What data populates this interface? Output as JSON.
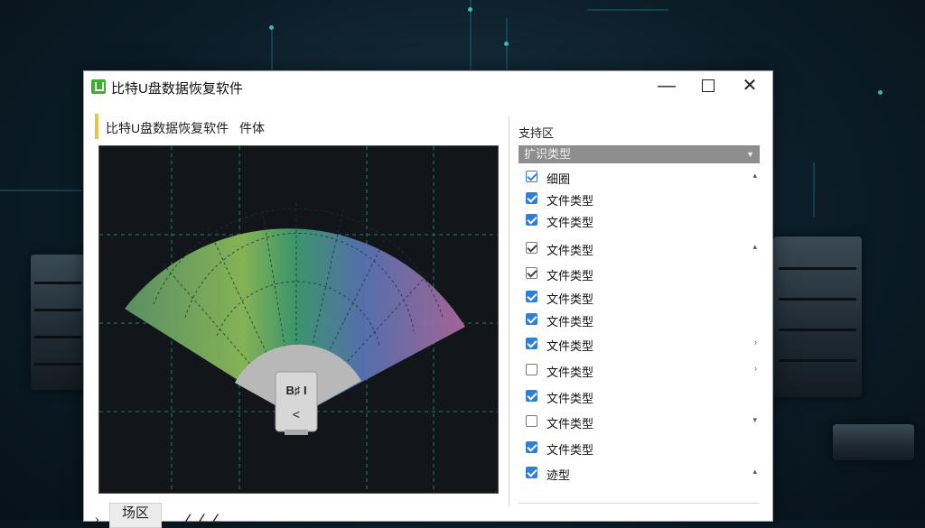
{
  "window": {
    "title": "比特U盘数据恢复软件",
    "controls": {
      "minimize": "—",
      "close": "✕"
    }
  },
  "header": {
    "title": "比特U盘数据恢复软件",
    "extra": "件体"
  },
  "preview": {
    "device_label_top": "B♯ I",
    "device_label_bottom": "<"
  },
  "right_panel": {
    "label": "支持区",
    "dropdown_value": "扩识类型",
    "items": [
      {
        "label": "细圈",
        "checked": true,
        "style": "outline",
        "chevron": "▴"
      },
      {
        "label": "文件类型",
        "checked": true,
        "style": "blue",
        "chevron": ""
      },
      {
        "label": "文件类型",
        "checked": true,
        "style": "blue",
        "chevron": ""
      },
      {
        "label": "文件类型",
        "checked": true,
        "style": "grey",
        "chevron": "▴"
      },
      {
        "label": "文件类型",
        "checked": true,
        "style": "grey",
        "chevron": ""
      },
      {
        "label": "文件类型",
        "checked": true,
        "style": "blue",
        "chevron": ""
      },
      {
        "label": "文件类型",
        "checked": true,
        "style": "blue",
        "chevron": ""
      },
      {
        "label": "文件类型",
        "checked": true,
        "style": "blue",
        "chevron": "›"
      },
      {
        "label": "文件类型",
        "checked": false,
        "style": "blue",
        "chevron": "›"
      },
      {
        "label": "文件类型",
        "checked": true,
        "style": "blue",
        "chevron": ""
      },
      {
        "label": "文件类型",
        "checked": false,
        "style": "blue",
        "chevron": "▾"
      },
      {
        "label": "文件类型",
        "checked": true,
        "style": "blue",
        "chevron": ""
      },
      {
        "label": "迹型",
        "checked": true,
        "style": "blue",
        "chevron": "▴"
      }
    ]
  },
  "bottom": {
    "tab_label": "场区",
    "chevron": "›",
    "extra": "∠ ∠ ∠"
  },
  "colors": {
    "accent": "#2f7fd4",
    "header_bar": "#e8c34c",
    "app_icon": "#3fae35"
  }
}
